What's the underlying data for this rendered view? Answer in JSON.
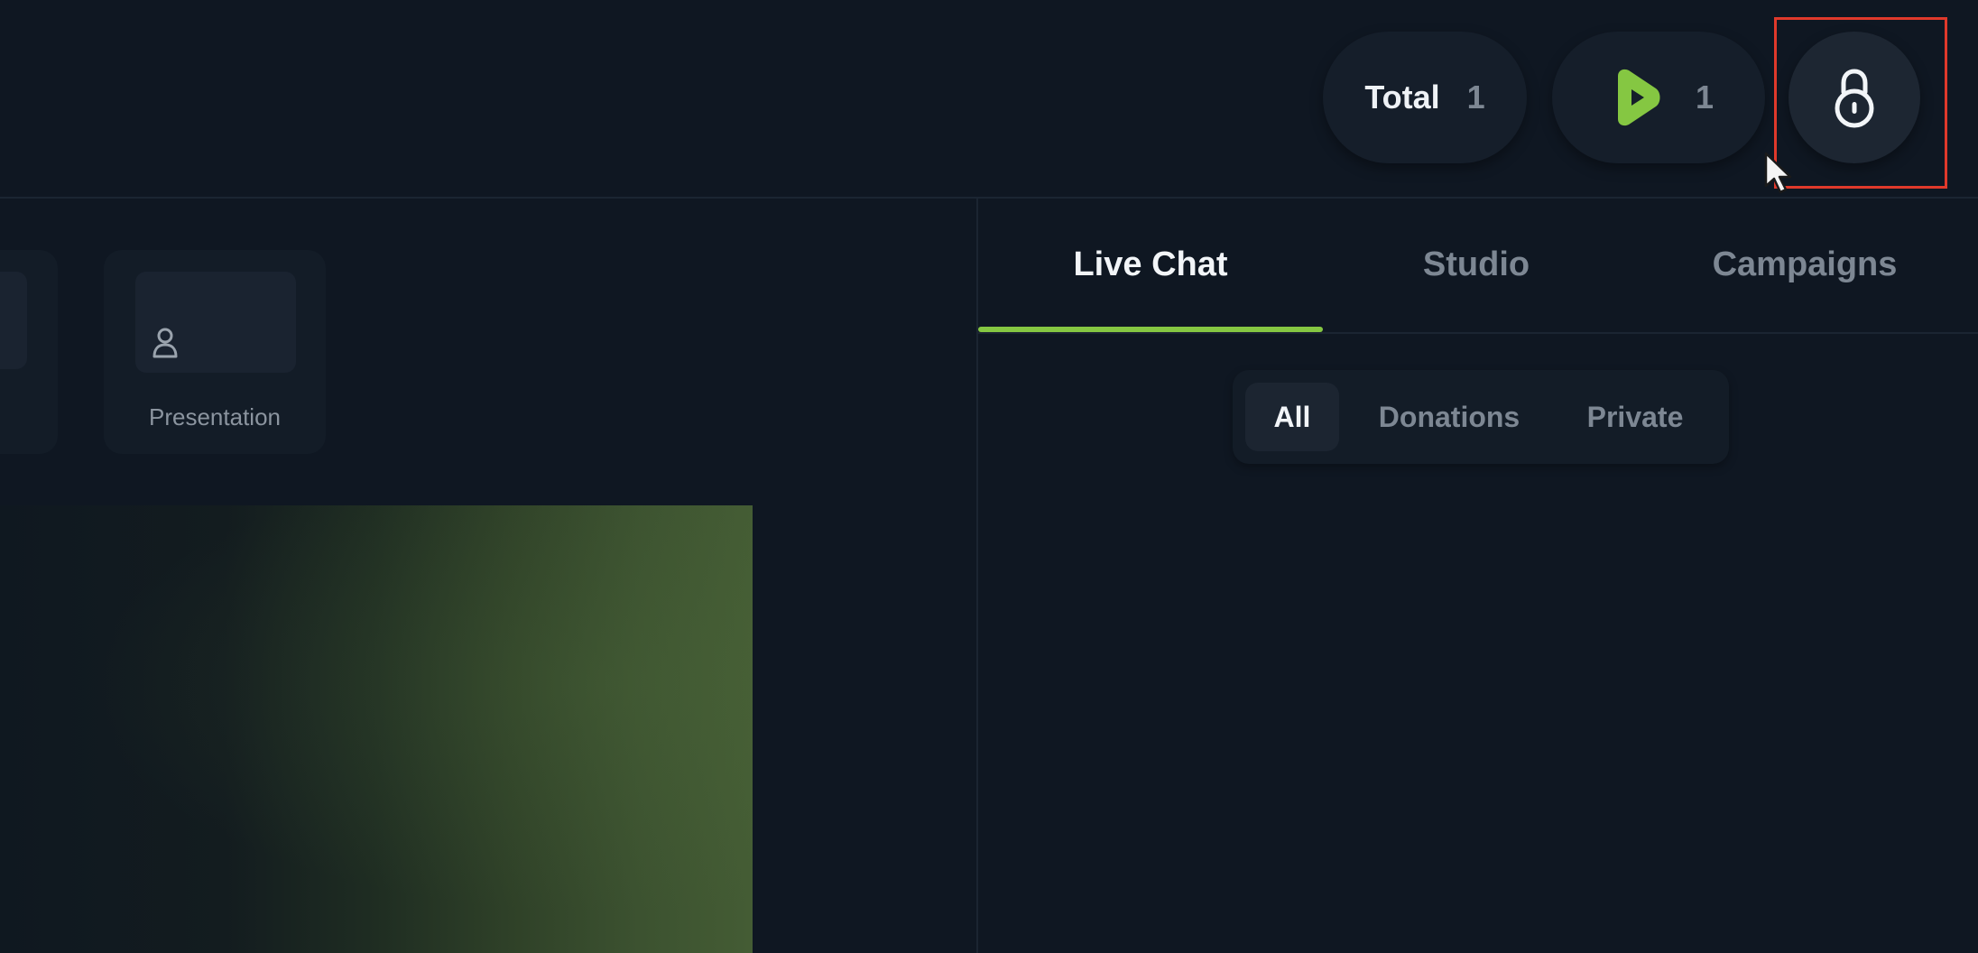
{
  "header": {
    "total": {
      "label": "Total",
      "count": "1"
    },
    "rumble": {
      "icon": "rumble-play-icon",
      "count": "1",
      "icon_color": "#85c742"
    },
    "lock_button": {
      "icon": "lock-icon"
    }
  },
  "scenes": {
    "items": [
      {
        "label": "Presentation",
        "icon": "person-icon"
      }
    ]
  },
  "right_panel": {
    "tabs": [
      {
        "label": "Live Chat",
        "active": true
      },
      {
        "label": "Studio",
        "active": false
      },
      {
        "label": "Campaigns",
        "active": false
      }
    ],
    "filters": [
      {
        "label": "All",
        "active": true
      },
      {
        "label": "Donations",
        "active": false
      },
      {
        "label": "Private",
        "active": false
      }
    ]
  },
  "colors": {
    "accent": "#85c742",
    "highlight": "#e0392b",
    "background": "#0f1722"
  }
}
